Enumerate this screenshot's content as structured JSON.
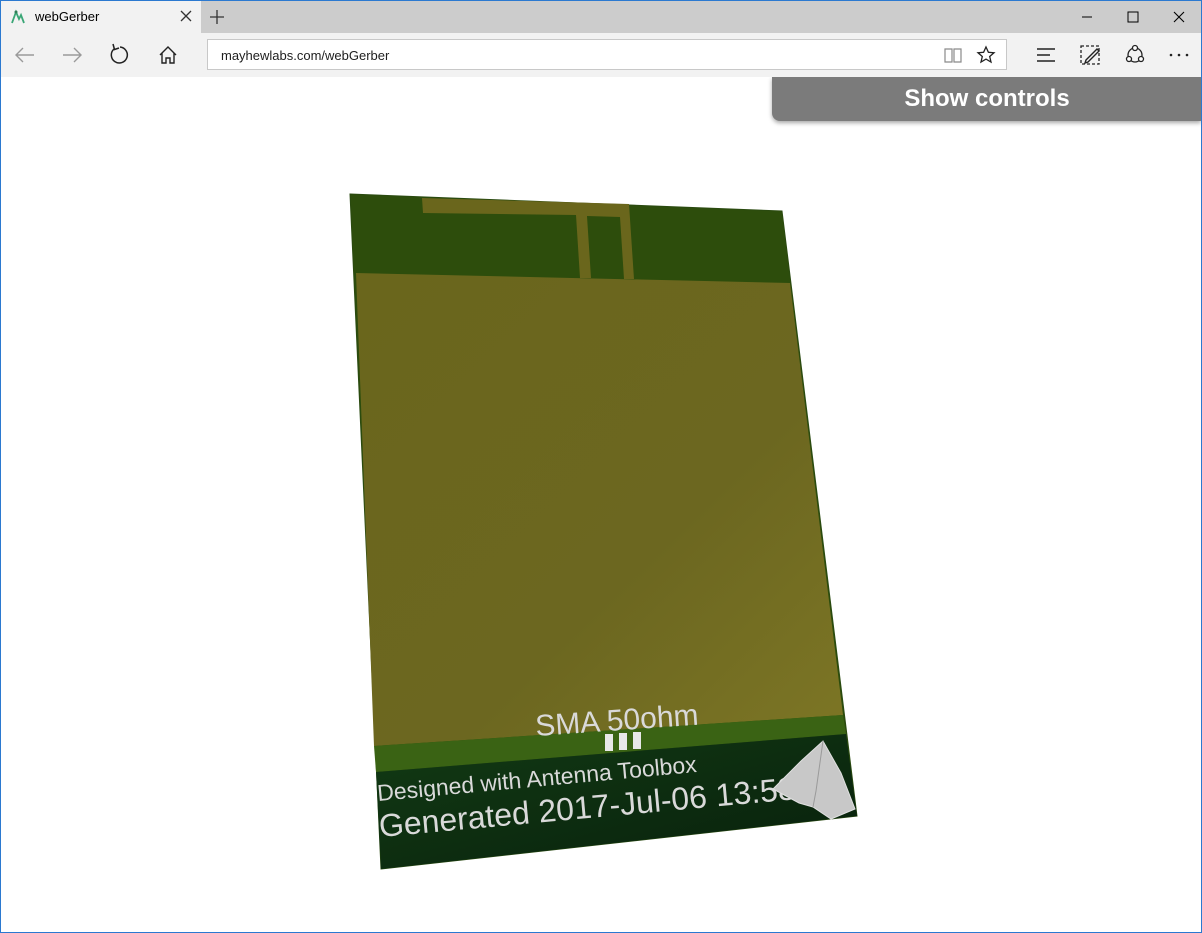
{
  "browser": {
    "tab_title": "webGerber",
    "url": "mayhewlabs.com/webGerber"
  },
  "page": {
    "show_controls_label": "Show controls"
  },
  "board": {
    "silkscreen_connector": "SMA 50ohm",
    "silkscreen_credit": "Designed with Antenna Toolbox",
    "silkscreen_generated": "Generated 2017-Jul-06 13:58",
    "colors": {
      "soldermask": "#2d4d0c",
      "copper_pour": "#6f6a1f",
      "bottom_panel": "#0f2a10",
      "silkscreen": "#d9d9d9"
    }
  },
  "icons": {
    "favicon": "webgerber-logo-icon",
    "tab_close": "close-icon",
    "new_tab": "plus-icon",
    "back": "arrow-left-icon",
    "forward": "arrow-right-icon",
    "refresh": "refresh-icon",
    "home": "home-icon",
    "reading_view": "book-icon",
    "favorites": "star-icon",
    "hub": "hub-icon",
    "web_note": "pen-note-icon",
    "share": "share-icon",
    "more": "ellipsis-icon",
    "board_logo": "matlab-membrane-logo-icon"
  }
}
